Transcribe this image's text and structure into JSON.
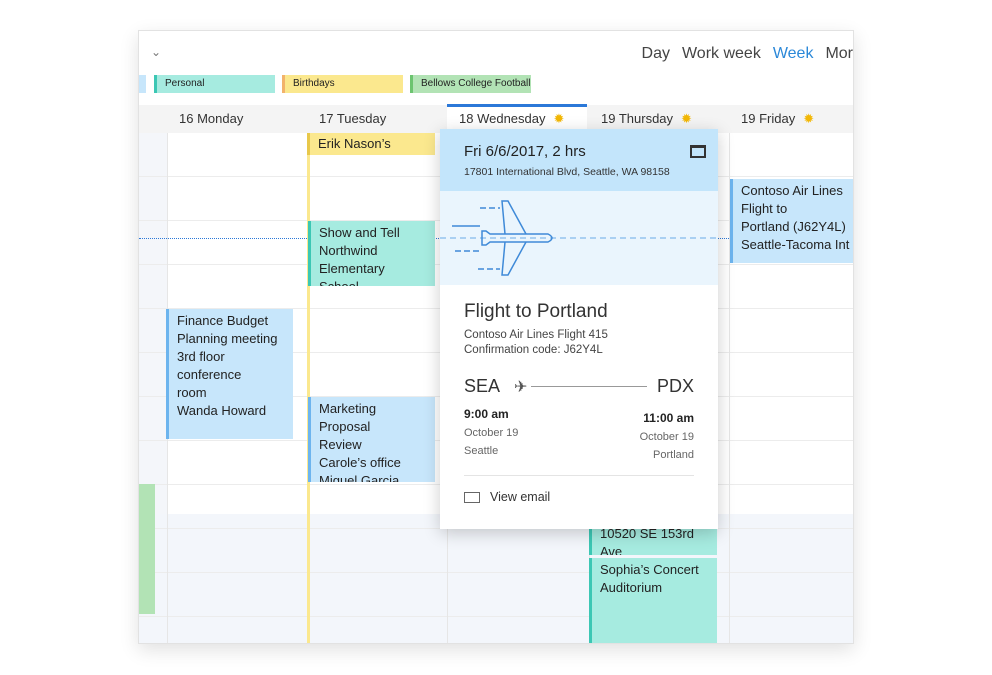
{
  "views": [
    "Day",
    "Work week",
    "Week",
    "Mor"
  ],
  "active_view": "Week",
  "categories": [
    {
      "label": "Personal",
      "bg": "#a6ebe0",
      "border": "#3cc7b4"
    },
    {
      "label": "Birthdays",
      "bg": "#fbe88e",
      "border": "#f2b36b"
    },
    {
      "label": "Bellows College Football",
      "bg": "#b2e3b5",
      "border": "#6cc470"
    }
  ],
  "days": [
    "16 Monday",
    "17 Tuesday",
    "18 Wednesday",
    "19 Thursday",
    "19 Friday"
  ],
  "events": {
    "birthday": "Erik Nason’s Birthda",
    "show": [
      "Show and Tell",
      "Northwind",
      "Elementary School"
    ],
    "finance": [
      "Finance Budget",
      "Planning meeting",
      "3rd floor conference",
      "room",
      "Wanda Howard"
    ],
    "marketing": [
      "Marketing Proposal",
      "Review",
      "Carole’s office",
      "Miguel Garcia"
    ],
    "contoso": [
      "Contoso Air Lines",
      "Flight to",
      "Portland (J62Y4L)",
      "Seattle-Tacoma Int"
    ],
    "address": "10520 SE 153rd Ave",
    "concert": [
      "Sophia’s Concert",
      "Auditorium"
    ]
  },
  "popup": {
    "when": "Fri 6/6/2017, 2 hrs",
    "where": "17801 International Blvd, Seattle, WA 98158",
    "title": "Flight to Portland",
    "flight": "Contoso Air Lines Flight 415",
    "confirmation": "Confirmation code: J62Y4L",
    "from": {
      "code": "SEA",
      "time": "9:00 am",
      "date": "October 19",
      "city": "Seattle"
    },
    "to": {
      "code": "PDX",
      "time": "11:00 am",
      "date": "October 19",
      "city": "Portland"
    },
    "view_email": "View email"
  }
}
